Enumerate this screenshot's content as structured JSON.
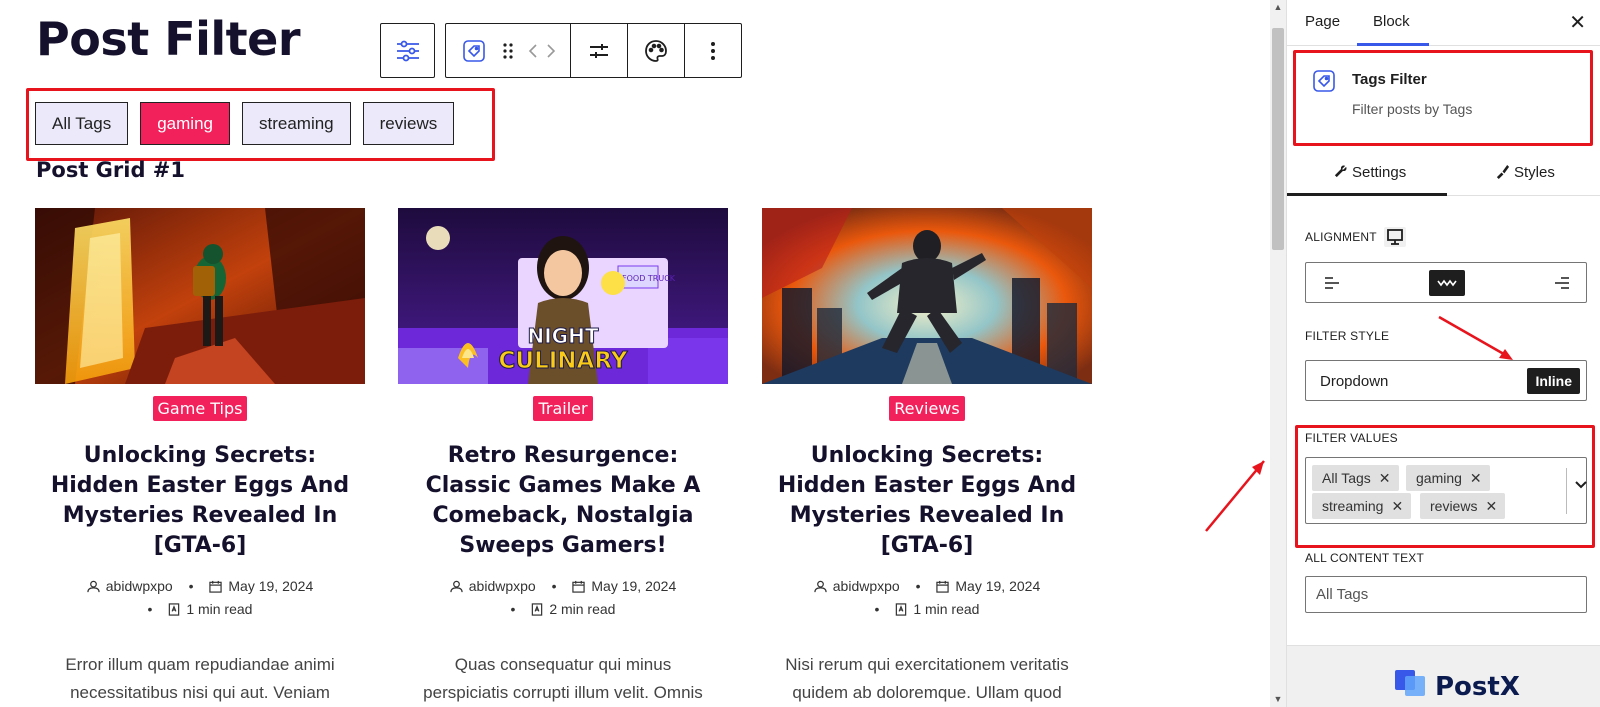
{
  "page": {
    "title": "Post Filter"
  },
  "toolbar": {
    "icons": [
      "filter-sliders-icon",
      "tag-icon",
      "drag-handle-icon",
      "arrows-icon",
      "settings-sliders-icon",
      "palette-icon",
      "more-vertical-icon"
    ]
  },
  "tags": [
    {
      "label": "All Tags",
      "active": false
    },
    {
      "label": "gaming",
      "active": true
    },
    {
      "label": "streaming",
      "active": false
    },
    {
      "label": "reviews",
      "active": false
    }
  ],
  "grid": {
    "heading": "Post Grid #1",
    "posts": [
      {
        "category": "Game Tips",
        "title": "Unlocking Secrets: Hidden Easter Eggs And Mysteries Revealed In [GTA-6]",
        "author": "abidwpxpo",
        "date": "May 19, 2024",
        "read_time": "1 min read",
        "excerpt_1": "Error illum quam repudiandae animi",
        "excerpt_2": "necessitatibus nisi qui aut. Veniam"
      },
      {
        "category": "Trailer",
        "title": "Retro Resurgence: Classic Games Make A Comeback, Nostalgia Sweeps Gamers!",
        "author": "abidwpxpo",
        "date": "May 19, 2024",
        "read_time": "2 min read",
        "excerpt_1": "Quas consequatur qui minus",
        "excerpt_2": "perspiciatis corrupti illum velit. Omnis",
        "image_text_1": "NIGHT",
        "image_text_2": "CULINARY",
        "image_text_3": "FOOD TRUCK"
      },
      {
        "category": "Reviews",
        "title": "Unlocking Secrets: Hidden Easter Eggs And Mysteries Revealed In [GTA-6]",
        "author": "abidwpxpo",
        "date": "May 19, 2024",
        "read_time": "1 min read",
        "excerpt_1": "Nisi rerum qui exercitationem veritatis",
        "excerpt_2": "quidem ab doloremque. Ullam quod"
      }
    ]
  },
  "sidebar": {
    "tab_page": "Page",
    "tab_block": "Block",
    "block_name": "Tags Filter",
    "block_desc": "Filter posts by Tags",
    "tab_settings": "Settings",
    "tab_styles": "Styles",
    "alignment_label": "ALIGNMENT",
    "filter_style_label": "FILTER STYLE",
    "filter_style_options": [
      "Dropdown",
      "Inline"
    ],
    "filter_style_selected": "Inline",
    "filter_values_label": "FILTER VALUES",
    "filter_values": [
      "All Tags",
      "gaming",
      "streaming",
      "reviews"
    ],
    "all_content_label": "ALL CONTENT TEXT",
    "all_content_value": "All Tags",
    "footer_brand": "PostX"
  },
  "colors": {
    "accent": "#f2215c",
    "highlight": "#e8141d",
    "wp_blue": "#3858e9",
    "dark": "#15102b"
  }
}
